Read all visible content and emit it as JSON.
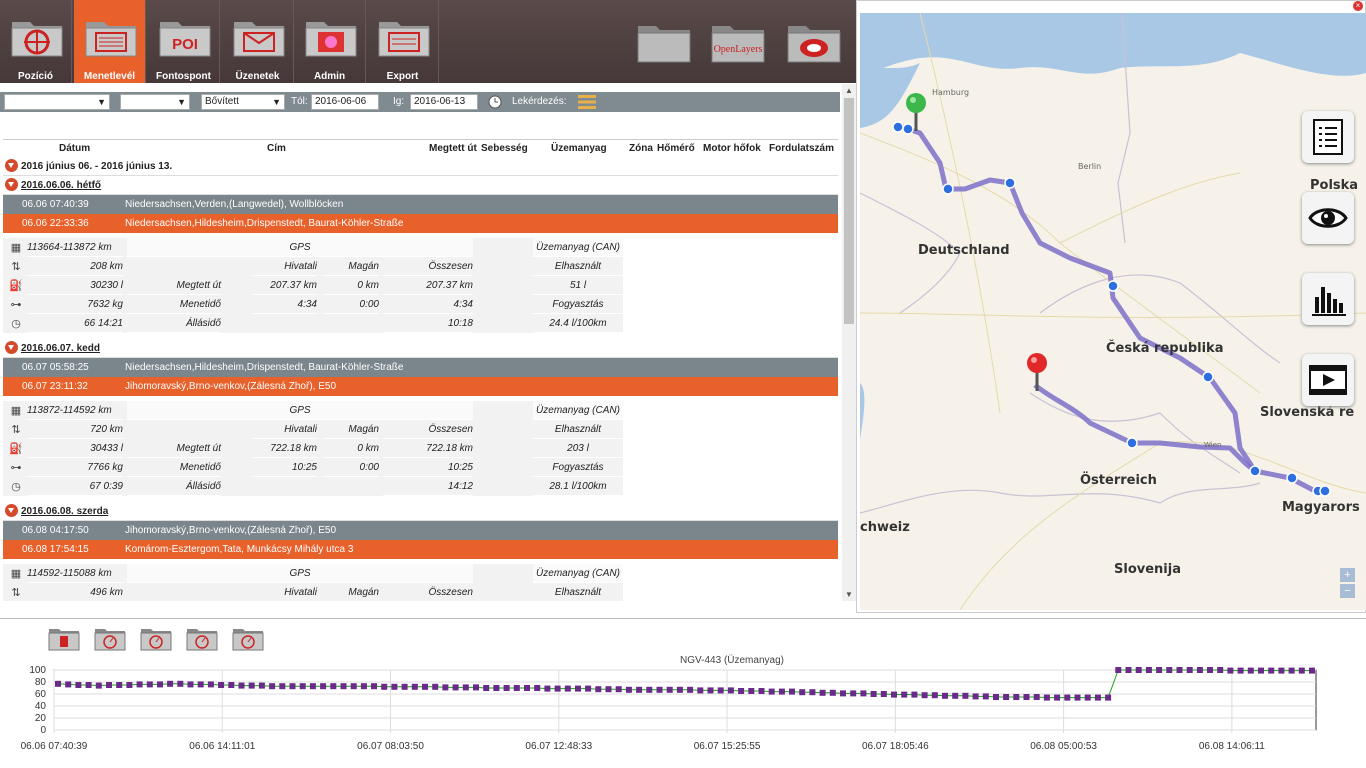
{
  "toolbar": {
    "items": [
      {
        "label": "Pozíció",
        "icon": "crosshair-folder-icon"
      },
      {
        "label": "Menetlevél",
        "icon": "list-folder-icon",
        "active": true
      },
      {
        "label": "Fontospont",
        "icon": "poi-folder-icon",
        "text": "POI"
      },
      {
        "label": "Üzenetek",
        "icon": "envelope-folder-icon"
      },
      {
        "label": "Admin",
        "icon": "admin-folder-icon"
      },
      {
        "label": "Export",
        "icon": "export-folder-icon"
      }
    ],
    "right": {
      "openlayers": "OpenLayers"
    }
  },
  "filter": {
    "select1": "",
    "select2": "",
    "mode": "Bővített",
    "from_label": "Tól:",
    "from": "2016-06-06",
    "to_label": "Ig:",
    "to": "2016-06-13",
    "query_label": "Lekérdezés:"
  },
  "columns": [
    "Dátum",
    "Cím",
    "Megtett út",
    "Sebesség",
    "Üzemanyag",
    "Zóna",
    "Hőmérő",
    "Motor hőfok",
    "Fordulatszám"
  ],
  "period": "2016 június 06. - 2016 június 13.",
  "days": [
    {
      "date": "2016.06.06. hétfő",
      "start_time": "06.06 07:40:39",
      "start_addr": "Niedersachsen,Verden,(Langwedel), Wollblöcken",
      "end_time": "06.06 22:33:36",
      "end_addr": "Niedersachsen,Hildesheim,Drispenstedt, Baurat-Köhler-Straße",
      "km": "113664-113872 km",
      "dist": "208 km",
      "fuel_l": "30230 l",
      "weight": "7632 kg",
      "hours": "66 14:21",
      "gps": "GPS",
      "hivatali": "Hivatali",
      "magan": "Magán",
      "osszesen": "Összesen",
      "megtett_lbl": "Megtett út",
      "megtett": [
        "207.37 km",
        "0 km",
        "207.37 km"
      ],
      "menetido_lbl": "Menetidő",
      "menetido": [
        "4:34",
        "0:00",
        "4:34"
      ],
      "allasido_lbl": "Állásidő",
      "allasido": "10:18",
      "fuel_hdr": "Üzemanyag (CAN)",
      "used_lbl": "Elhasznált",
      "used": "51 l",
      "cons_lbl": "Fogyasztás",
      "cons": "24.4 l/100km"
    },
    {
      "date": "2016.06.07. kedd",
      "start_time": "06.07 05:58:25",
      "start_addr": "Niedersachsen,Hildesheim,Drispenstedt, Baurat-Köhler-Straße",
      "end_time": "06.07 23:11:32",
      "end_addr": "Jihomoravský,Brno-venkov,(Zálesná Zhoř), E50",
      "km": "113872-114592 km",
      "dist": "720 km",
      "fuel_l": "30433 l",
      "weight": "7766 kg",
      "hours": "67 0:39",
      "gps": "GPS",
      "hivatali": "Hivatali",
      "magan": "Magán",
      "osszesen": "Összesen",
      "megtett_lbl": "Megtett út",
      "megtett": [
        "722.18 km",
        "0 km",
        "722.18 km"
      ],
      "menetido_lbl": "Menetidő",
      "menetido": [
        "10:25",
        "0:00",
        "10:25"
      ],
      "allasido_lbl": "Állásidő",
      "allasido": "14:12",
      "fuel_hdr": "Üzemanyag (CAN)",
      "used_lbl": "Elhasznált",
      "used": "203 l",
      "cons_lbl": "Fogyasztás",
      "cons": "28.1 l/100km"
    },
    {
      "date": "2016.06.08. szerda",
      "start_time": "06.08 04:17:50",
      "start_addr": "Jihomoravský,Brno-venkov,(Zálesná Zhoř), E50",
      "end_time": "06.08 17:54:15",
      "end_addr": "Komárom-Esztergom,Tata, Munkácsy Mihály utca 3",
      "km": "114592-115088 km",
      "dist": "496 km",
      "gps": "GPS",
      "hivatali": "Hivatali",
      "magan": "Magán",
      "osszesen": "Összesen",
      "fuel_hdr": "Üzemanyag (CAN)",
      "used_lbl": "Elhasznált"
    }
  ],
  "map": {
    "labels": [
      "Hamburg",
      "Berlin",
      "Polska",
      "Deutschland",
      "Česká republika",
      "Slovenská re",
      "Österreich",
      "chweiz",
      "Magyarors",
      "Slovenija",
      "Wien"
    ],
    "zoom_in": "+",
    "zoom_out": "−"
  },
  "chart_data": {
    "type": "line",
    "title": "NGV-443 (Üzemanyag)",
    "ylim": [
      0,
      100
    ],
    "yticks": [
      0,
      20,
      40,
      60,
      80,
      100
    ],
    "xticks": [
      "06.06 07:40:39",
      "06.06 14:11:01",
      "06.07 08:03:50",
      "06.07 12:48:33",
      "06.07 15:25:55",
      "06.07 18:05:46",
      "06.08 05:00:53",
      "06.08 14:06:11"
    ],
    "series": [
      {
        "values": [
          77,
          76,
          75,
          75,
          74,
          75,
          75,
          75,
          76,
          76,
          76,
          77,
          77,
          76,
          76,
          76,
          75,
          75,
          74,
          74,
          74,
          73,
          73,
          73,
          73,
          73,
          73,
          73,
          73,
          73,
          73,
          73,
          72,
          72,
          72,
          72,
          72,
          72,
          71,
          71,
          71,
          71,
          70,
          70,
          70,
          70,
          70,
          70,
          69,
          69,
          69,
          69,
          69,
          68,
          68,
          68,
          67,
          67,
          67,
          67,
          67,
          67,
          67,
          66,
          66,
          66,
          66,
          65,
          65,
          65,
          64,
          64,
          64,
          63,
          63,
          62,
          62,
          61,
          61,
          61,
          60,
          60,
          59,
          59,
          59,
          58,
          58,
          57,
          57,
          57,
          56,
          56,
          55,
          55,
          55,
          55,
          55,
          54,
          54,
          54,
          54,
          54,
          54,
          54,
          100,
          100,
          100,
          100,
          100,
          100,
          100,
          100,
          100,
          100,
          100,
          99,
          99,
          99,
          99,
          99,
          99,
          99,
          99,
          99
        ]
      }
    ]
  },
  "bottom_icons": [
    "fuel-folder-icon",
    "gauge-folder-icon",
    "gauge-folder-icon",
    "gauge-folder-icon",
    "gauge-folder-icon"
  ]
}
